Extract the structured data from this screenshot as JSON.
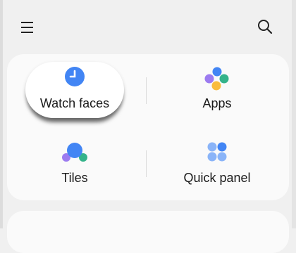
{
  "header": {
    "menu_icon": "menu-icon",
    "search_icon": "search-icon"
  },
  "grid": {
    "items": [
      {
        "label": "Watch faces",
        "icon": "clock-icon",
        "highlighted": true
      },
      {
        "label": "Apps",
        "icon": "apps-icon"
      },
      {
        "label": "Tiles",
        "icon": "tiles-icon"
      },
      {
        "label": "Quick panel",
        "icon": "quick-panel-icon"
      }
    ]
  },
  "colors": {
    "background": "#f0f0f0",
    "card": "#fafafa",
    "blue": "#4285f4",
    "purple": "#9c7bf0",
    "green": "#34b38a",
    "yellow": "#f9bc3c",
    "light_blue": "#8ab4f8"
  }
}
